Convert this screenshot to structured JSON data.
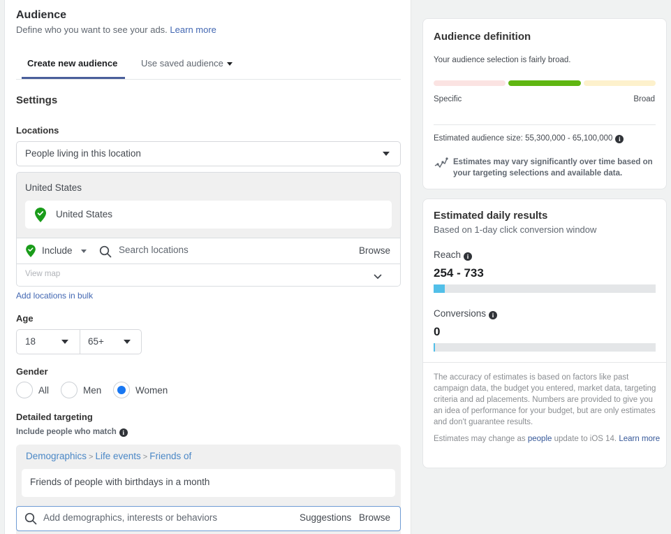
{
  "audience": {
    "title": "Audience",
    "subtitle": "Define who you want to see your ads.",
    "learn_more": "Learn more",
    "tabs": [
      {
        "label": "Create new audience",
        "active": true
      },
      {
        "label": "Use saved audience",
        "active": false
      }
    ]
  },
  "settings": {
    "heading": "Settings",
    "locations": {
      "label": "Locations",
      "type_select": "People living in this location",
      "group_title": "United States",
      "selected": [
        "United States"
      ],
      "include_label": "Include",
      "search_placeholder": "Search locations",
      "browse_label": "Browse",
      "view_map_label": "View map",
      "add_bulk_label": "Add locations in bulk"
    },
    "age": {
      "label": "Age",
      "min": "18",
      "max": "65+"
    },
    "gender": {
      "label": "Gender",
      "options": [
        "All",
        "Men",
        "Women"
      ],
      "selected": "Women"
    },
    "detailed_targeting": {
      "label": "Detailed targeting",
      "include_label": "Include people who match",
      "breadcrumb": [
        "Demographics",
        "Life events",
        "Friends of"
      ],
      "breadcrumb_sep": ">",
      "selected_item": "Friends of people with birthdays in a month",
      "search_placeholder": "Add demographics, interests or behaviors",
      "suggestions_label": "Suggestions",
      "browse_label": "Browse"
    }
  },
  "audience_definition": {
    "title": "Audience definition",
    "status": "Your audience selection is fairly broad.",
    "meter_position": "middle",
    "meter_colors": {
      "specific": "#fbe3e2",
      "middle": "#5fb611",
      "broad": "#fdf1cc"
    },
    "specific_label": "Specific",
    "broad_label": "Broad",
    "size_label": "Estimated audience size:",
    "size_value": "55,300,000 - 65,100,000",
    "note": "Estimates may vary significantly over time based on your targeting selections and available data."
  },
  "daily_results": {
    "title": "Estimated daily results",
    "subtitle": "Based on 1-day click conversion window",
    "reach": {
      "label": "Reach",
      "value": "254 - 733",
      "fill_fraction": 0.05
    },
    "conversions": {
      "label": "Conversions",
      "value": "0",
      "fill_fraction": 0.005
    },
    "disclaimer": "The accuracy of estimates is based on factors like past campaign data, the budget you entered, market data, targeting criteria and ad placements. Numbers are provided to give you an idea of performance for your budget, but are only estimates and don't guarantee results.",
    "ios_prefix": "Estimates may change as",
    "ios_link": "people",
    "ios_middle": "update to iOS 14.",
    "ios_learn_more": "Learn more"
  }
}
